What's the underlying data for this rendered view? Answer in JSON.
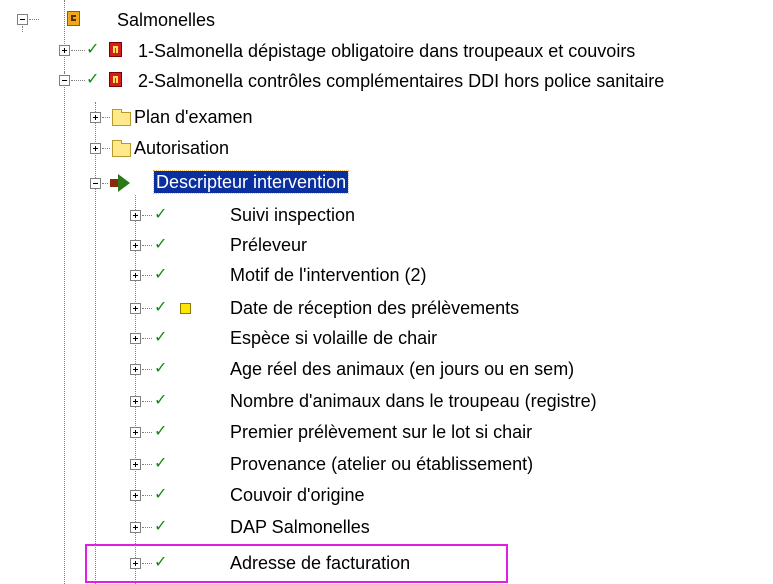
{
  "tree": {
    "root": {
      "label": "Salmonelles"
    },
    "level1": [
      {
        "label": "1-Salmonella  dépistage obligatoire  dans troupeaux et couvoirs",
        "checked": true,
        "expanded": false
      },
      {
        "label": "2-Salmonella contrôles complémentaires DDI hors police sanitaire",
        "checked": true,
        "expanded": true
      }
    ],
    "level2": [
      {
        "label": "Plan d'examen",
        "icon": "folder-icon",
        "expanded": false
      },
      {
        "label": "Autorisation",
        "icon": "folder-icon",
        "expanded": false
      },
      {
        "label": "Descripteur intervention",
        "icon": "green-arrow-icon",
        "expanded": true,
        "selected": true
      }
    ],
    "descriptor_items": [
      {
        "label": "Suivi inspection",
        "checked": true
      },
      {
        "label": "Préleveur",
        "checked": true
      },
      {
        "label": "Motif de l'intervention (2)",
        "checked": true
      },
      {
        "label": "Date de réception des prélèvements",
        "checked": true,
        "extra_icon": "yellow-square-icon"
      },
      {
        "label": "Espèce si volaille de chair",
        "checked": true
      },
      {
        "label": "Age réel des animaux (en jours ou en sem)",
        "checked": true
      },
      {
        "label": "Nombre d'animaux dans le troupeau (registre)",
        "checked": true
      },
      {
        "label": "Premier prélèvement sur le lot si chair",
        "checked": true
      },
      {
        "label": "Provenance (atelier ou établissement)",
        "checked": true
      },
      {
        "label": "Couvoir d'origine",
        "checked": true
      },
      {
        "label": "DAP Salmonelles",
        "checked": true
      },
      {
        "label": "Adresse de facturation",
        "checked": true,
        "annotated": true
      }
    ]
  },
  "colors": {
    "selection_bg": "#0a2f9e",
    "check": "#128a12",
    "annotation_box": "#e020e0"
  },
  "glyphs": {
    "check": "✓"
  }
}
